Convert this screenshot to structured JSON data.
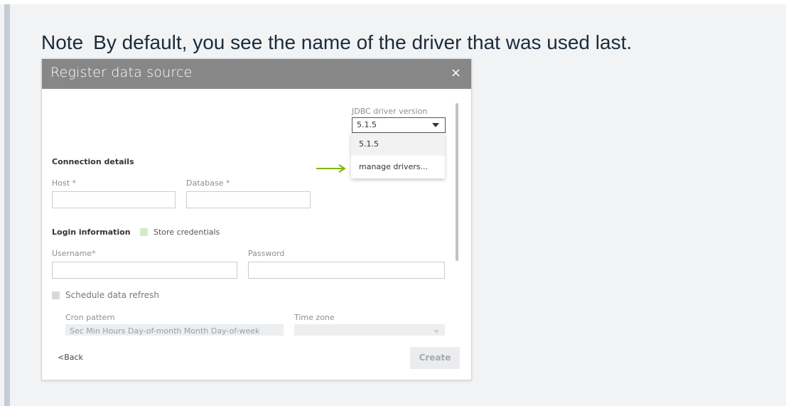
{
  "note": {
    "label": "Note",
    "text": "By default, you see the name of the driver that was used last."
  },
  "dialog": {
    "title": "Register data source",
    "close_glyph": "×",
    "jdbc": {
      "label": "JDBC driver version",
      "selected": "5.1.5",
      "options": [
        "5.1.5",
        "manage drivers..."
      ]
    },
    "connection": {
      "title": "Connection details",
      "host_label": "Host *",
      "database_label": "Database *",
      "host_value": "",
      "database_value": ""
    },
    "login": {
      "title": "Login information",
      "store_label": "Store credentials",
      "store_checked": false,
      "username_label": "Username*",
      "password_label": "Password",
      "username_value": "",
      "password_value": ""
    },
    "schedule": {
      "label": "Schedule data refresh",
      "checked": false,
      "cron_label": "Cron pattern",
      "cron_placeholder": "Sec Min Hours Day-of-month Month Day-of-week",
      "timezone_label": "Time zone"
    },
    "footer": {
      "back_label": "Back",
      "back_glyph": "<",
      "create_label": "Create"
    }
  },
  "colors": {
    "header_bg": "#878787",
    "arrow_green": "#7ab800",
    "store_checkbox": "#d4ecc6",
    "schedule_checkbox": "#d9d9d9",
    "note_text": "#1b2c3a"
  },
  "icons": {
    "close": "close-icon",
    "caret": "chevron-down-icon",
    "pointer": "arrow-right-icon"
  }
}
